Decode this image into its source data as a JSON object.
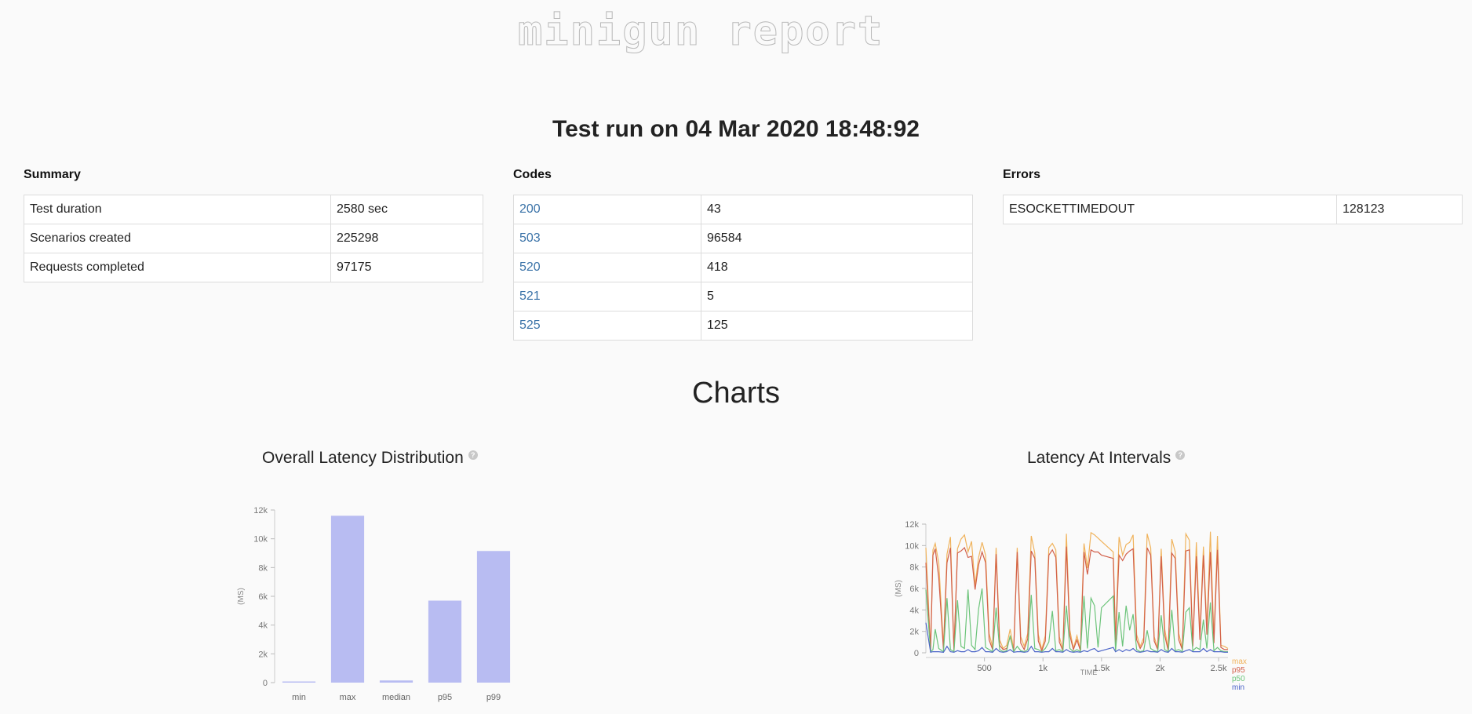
{
  "logo": "minigun report",
  "run_title": "Test run on 04 Mar 2020 18:48:92",
  "summary": {
    "title": "Summary",
    "rows": [
      {
        "label": "Test duration",
        "value": "2580 sec"
      },
      {
        "label": "Scenarios created",
        "value": "225298"
      },
      {
        "label": "Requests completed",
        "value": "97175"
      }
    ]
  },
  "codes": {
    "title": "Codes",
    "rows": [
      {
        "code": "200",
        "count": "43"
      },
      {
        "code": "503",
        "count": "96584"
      },
      {
        "code": "520",
        "count": "418"
      },
      {
        "code": "521",
        "count": "5"
      },
      {
        "code": "525",
        "count": "125"
      }
    ]
  },
  "errors": {
    "title": "Errors",
    "rows": [
      {
        "name": "ESOCKETTIMEDOUT",
        "count": "128123"
      }
    ]
  },
  "charts_heading": "Charts",
  "help_icon": "?",
  "colors": {
    "bar": "#b8bcf2",
    "max": "#f0b35c",
    "p95": "#d2604a",
    "p50": "#6cc47a",
    "min": "#4b64c8",
    "link": "#3b73a8"
  },
  "chart_data": [
    {
      "type": "bar",
      "title": "Overall Latency Distribution",
      "ylabel": "(MS)",
      "categories": [
        "min",
        "max",
        "median",
        "p95",
        "p99"
      ],
      "values": [
        80,
        11600,
        150,
        5700,
        9150
      ],
      "ylim": [
        0,
        12000
      ],
      "yticks": [
        0,
        2000,
        4000,
        6000,
        8000,
        10000,
        12000
      ],
      "ytick_labels": [
        "0",
        "2k",
        "4k",
        "6k",
        "8k",
        "10k",
        "12k"
      ]
    },
    {
      "type": "line",
      "title": "Latency At Intervals",
      "xlabel": "TIME",
      "ylabel": "(MS)",
      "xlim": [
        0,
        2580
      ],
      "ylim": [
        0,
        12000
      ],
      "xticks": [
        500,
        1000,
        1500,
        2000,
        2500
      ],
      "xtick_labels": [
        "500",
        "1k",
        "1.5k",
        "2k",
        "2.5k"
      ],
      "yticks": [
        0,
        2000,
        4000,
        6000,
        8000,
        10000,
        12000
      ],
      "ytick_labels": [
        "0",
        "2k",
        "4k",
        "6k",
        "8k",
        "10k",
        "12k"
      ],
      "legend_position": "right-bottom",
      "x": [
        0,
        40,
        60,
        80,
        110,
        150,
        180,
        210,
        240,
        270,
        300,
        330,
        360,
        390,
        420,
        450,
        480,
        510,
        540,
        570,
        600,
        630,
        660,
        690,
        720,
        750,
        780,
        810,
        840,
        870,
        900,
        930,
        960,
        990,
        1020,
        1050,
        1080,
        1110,
        1140,
        1170,
        1200,
        1230,
        1260,
        1290,
        1320,
        1350,
        1380,
        1410,
        1440,
        1470,
        1500,
        1600,
        1620,
        1650,
        1680,
        1710,
        1740,
        1770,
        1800,
        1830,
        1860,
        1890,
        1920,
        1950,
        1980,
        2010,
        2040,
        2070,
        2100,
        2130,
        2160,
        2190,
        2220,
        2250,
        2280,
        2310,
        2340,
        2370,
        2400,
        2430,
        2460,
        2490,
        2520,
        2550,
        2580
      ],
      "series": [
        {
          "name": "max",
          "values": [
            9800,
            300,
            9600,
            10200,
            8400,
            600,
            9200,
            10800,
            300,
            9700,
            10600,
            11000,
            9400,
            10400,
            6300,
            8900,
            10300,
            9100,
            1800,
            500,
            9800,
            1200,
            400,
            700,
            2200,
            300,
            9800,
            1500,
            600,
            1800,
            10900,
            9300,
            1700,
            300,
            1600,
            9800,
            10200,
            9600,
            1500,
            300,
            11100,
            2100,
            400,
            1600,
            300,
            10200,
            7900,
            11200,
            11000,
            10700,
            10400,
            9400,
            1300,
            10800,
            9100,
            10100,
            10300,
            11000,
            1700,
            600,
            1400,
            11100,
            9800,
            1500,
            400,
            9700,
            2200,
            300,
            10600,
            9400,
            1800,
            400,
            11100,
            10500,
            900,
            10300,
            1700,
            9900,
            2300,
            11300,
            1300,
            10900,
            700,
            600,
            400
          ]
        },
        {
          "name": "p95",
          "values": [
            8400,
            200,
            9100,
            9700,
            7000,
            300,
            8400,
            9800,
            200,
            9300,
            9500,
            9800,
            8900,
            9000,
            5900,
            8200,
            9400,
            8400,
            1200,
            300,
            9200,
            700,
            300,
            400,
            1500,
            200,
            9400,
            900,
            300,
            1300,
            9500,
            8800,
            1100,
            200,
            1100,
            9100,
            9600,
            8900,
            1000,
            200,
            9900,
            1600,
            300,
            1200,
            200,
            9400,
            7300,
            9600,
            9400,
            9400,
            9100,
            8800,
            900,
            9100,
            8600,
            9200,
            9500,
            9700,
            1200,
            400,
            1000,
            9800,
            9100,
            1100,
            300,
            9000,
            1600,
            200,
            9300,
            8800,
            1200,
            300,
            9500,
            9600,
            600,
            9000,
            1200,
            9100,
            1700,
            9400,
            900,
            9600,
            500,
            300,
            300
          ]
        },
        {
          "name": "p50",
          "values": [
            5900,
            100,
            300,
            2200,
            400,
            100,
            5100,
            300,
            100,
            4900,
            600,
            400,
            5900,
            700,
            300,
            4100,
            6000,
            500,
            300,
            100,
            4200,
            300,
            100,
            200,
            1600,
            100,
            600,
            200,
            100,
            300,
            5400,
            400,
            300,
            100,
            400,
            1000,
            3900,
            200,
            300,
            100,
            4400,
            400,
            100,
            300,
            100,
            5300,
            400,
            5100,
            4400,
            500,
            4200,
            5300,
            200,
            3800,
            600,
            4400,
            2100,
            3600,
            300,
            100,
            200,
            2100,
            400,
            200,
            100,
            3500,
            300,
            100,
            4000,
            200,
            300,
            100,
            3800,
            4200,
            200,
            500,
            300,
            3100,
            400,
            4700,
            200,
            500,
            200,
            100,
            100
          ]
        },
        {
          "name": "min",
          "values": [
            2800,
            50,
            100,
            100,
            100,
            50,
            600,
            100,
            50,
            200,
            100,
            100,
            300,
            100,
            100,
            200,
            500,
            100,
            100,
            50,
            400,
            100,
            50,
            100,
            300,
            50,
            100,
            100,
            50,
            100,
            600,
            100,
            100,
            50,
            100,
            100,
            400,
            100,
            100,
            50,
            300,
            100,
            50,
            100,
            50,
            200,
            100,
            300,
            400,
            100,
            200,
            500,
            100,
            300,
            100,
            300,
            200,
            400,
            100,
            50,
            100,
            200,
            100,
            100,
            50,
            300,
            100,
            50,
            400,
            100,
            100,
            50,
            200,
            300,
            100,
            100,
            100,
            400,
            100,
            300,
            100,
            100,
            100,
            50,
            50
          ]
        }
      ]
    }
  ]
}
